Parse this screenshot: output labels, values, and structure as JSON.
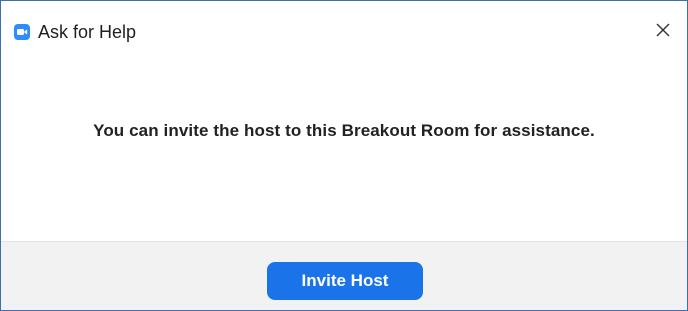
{
  "window": {
    "title": "Ask for Help",
    "app_icon": "zoom-camera-icon",
    "close_icon": "close-icon",
    "accent_color": "#2d8cff"
  },
  "content": {
    "message": "You can invite the host to this Breakout Room for assistance."
  },
  "footer": {
    "primary_button_label": "Invite Host",
    "primary_button_color": "#1a73e8"
  }
}
